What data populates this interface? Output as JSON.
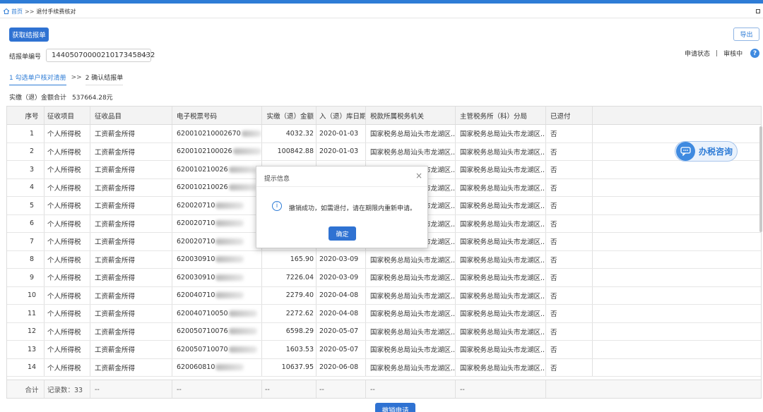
{
  "breadcrumb": {
    "home": "首页",
    "separator": ">>",
    "current": "退付手续费核对"
  },
  "toolbar": {
    "fetch_label": "获取结报单",
    "export_label": "导出"
  },
  "form": {
    "report_label": "结报单编号",
    "report_value": "1440507000021017345843​2"
  },
  "status": {
    "label": "申请状态",
    "separator": "|",
    "value": "审核中"
  },
  "steps": {
    "step1": "1 勾选单户核对清册",
    "arrow": ">>",
    "step2": "2 确认结报单"
  },
  "summary": {
    "label": "实缴（退）金额合计",
    "amount": "537664.28元"
  },
  "table": {
    "headers": [
      "序号",
      "征收项目",
      "征收品目",
      "电子税票号码",
      "实缴（退）金额",
      "入（退）库日期",
      "税款所属税务机关",
      "主管税务所（科）分局",
      "已退付"
    ],
    "rows": [
      {
        "idx": "1",
        "item": "个人所得税",
        "pm": "工资薪金所得",
        "tax": "620010210002670",
        "amt": "4032.32",
        "date": "2020-01-03",
        "org": "国家税务总局汕头市龙湖区...",
        "sub": "国家税务总局汕头市龙湖区...",
        "ret": "否"
      },
      {
        "idx": "2",
        "item": "个人所得税",
        "pm": "工资薪金所得",
        "tax": "6200102100026",
        "amt": "100842.88",
        "date": "2020-01-03",
        "org": "国家税务总局汕头市龙湖区...",
        "sub": "国家税务总局汕头市龙湖区...",
        "ret": "否"
      },
      {
        "idx": "3",
        "item": "个人所得税",
        "pm": "工资薪金所得",
        "tax": "620010210026",
        "amt": "",
        "date": "",
        "org": "国家税务总局汕头市龙湖区...",
        "sub": "国家税务总局汕头市龙湖区...",
        "ret": "否"
      },
      {
        "idx": "4",
        "item": "个人所得税",
        "pm": "工资薪金所得",
        "tax": "620010210026",
        "amt": "",
        "date": "",
        "org": "国家税务总局汕头市龙湖区...",
        "sub": "国家税务总局汕头市龙湖区...",
        "ret": "否"
      },
      {
        "idx": "5",
        "item": "个人所得税",
        "pm": "工资薪金所得",
        "tax": "620020710",
        "amt": "",
        "date": "",
        "org": "国家税务总局汕头市龙湖区...",
        "sub": "国家税务总局汕头市龙湖区...",
        "ret": "否"
      },
      {
        "idx": "6",
        "item": "个人所得税",
        "pm": "工资薪金所得",
        "tax": "620020710",
        "amt": "",
        "date": "",
        "org": "国家税务总局汕头市龙湖区...",
        "sub": "国家税务总局汕头市龙湖区...",
        "ret": "否"
      },
      {
        "idx": "7",
        "item": "个人所得税",
        "pm": "工资薪金所得",
        "tax": "620020710",
        "amt": "",
        "date": "",
        "org": "国家税务总局汕头市龙湖区...",
        "sub": "国家税务总局汕头市龙湖区...",
        "ret": "否"
      },
      {
        "idx": "8",
        "item": "个人所得税",
        "pm": "工资薪金所得",
        "tax": "620030910",
        "amt": "165.90",
        "date": "2020-03-09",
        "org": "国家税务总局汕头市龙湖区...",
        "sub": "国家税务总局汕头市龙湖区...",
        "ret": "否"
      },
      {
        "idx": "9",
        "item": "个人所得税",
        "pm": "工资薪金所得",
        "tax": "620030910",
        "amt": "7226.04",
        "date": "2020-03-09",
        "org": "国家税务总局汕头市龙湖区...",
        "sub": "国家税务总局汕头市龙湖区...",
        "ret": "否"
      },
      {
        "idx": "10",
        "item": "个人所得税",
        "pm": "工资薪金所得",
        "tax": "620040710",
        "amt": "2279.40",
        "date": "2020-04-08",
        "org": "国家税务总局汕头市龙湖区...",
        "sub": "国家税务总局汕头市龙湖区...",
        "ret": "否"
      },
      {
        "idx": "11",
        "item": "个人所得税",
        "pm": "工资薪金所得",
        "tax": "620040710050",
        "amt": "2272.62",
        "date": "2020-04-08",
        "org": "国家税务总局汕头市龙湖区...",
        "sub": "国家税务总局汕头市龙湖区...",
        "ret": "否"
      },
      {
        "idx": "12",
        "item": "个人所得税",
        "pm": "工资薪金所得",
        "tax": "620050710076",
        "amt": "6598.29",
        "date": "2020-05-07",
        "org": "国家税务总局汕头市龙湖区...",
        "sub": "国家税务总局汕头市龙湖区...",
        "ret": "否"
      },
      {
        "idx": "13",
        "item": "个人所得税",
        "pm": "工资薪金所得",
        "tax": "620050710070",
        "amt": "1603.53",
        "date": "2020-05-07",
        "org": "国家税务总局汕头市龙湖区...",
        "sub": "国家税务总局汕头市龙湖区...",
        "ret": "否"
      },
      {
        "idx": "14",
        "item": "个人所得税",
        "pm": "工资薪金所得",
        "tax": "620060810",
        "amt": "10637.95",
        "date": "2020-06-08",
        "org": "国家税务总局汕头市龙湖区...",
        "sub": "国家税务总局汕头市龙湖区...",
        "ret": "否"
      }
    ],
    "footer": {
      "label": "合计",
      "count": "记录数：33",
      "dash": "--"
    }
  },
  "consult": {
    "label": "办税咨询"
  },
  "dialog": {
    "title": "提示信息",
    "close": "×",
    "message": "撤销成功，如需退付，请在期限内重新申请。",
    "ok_label": "确定"
  },
  "actions": {
    "cancel_label": "撤销申请"
  },
  "colors": {
    "primary": "#2f72d2",
    "topbar": "#2e7cd6"
  }
}
